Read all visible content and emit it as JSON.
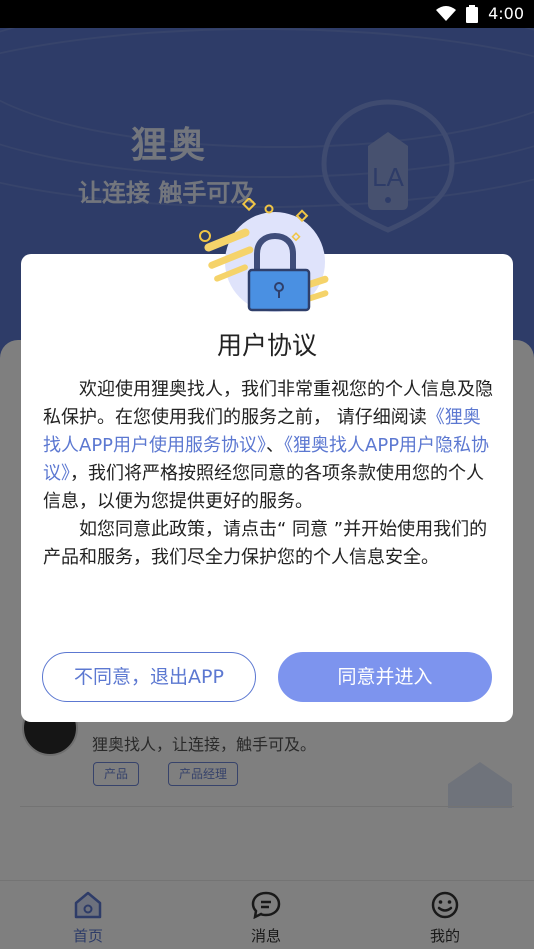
{
  "status_bar": {
    "time": "4:00"
  },
  "hero": {
    "title": "狸奥",
    "slogan": "让连接 触手可及",
    "logo_text": "LA"
  },
  "card": {
    "description": "狸奥找人，让连接，触手可及。",
    "tags": [
      "产品",
      "产品经理"
    ]
  },
  "bottom_nav": {
    "home": "首页",
    "messages": "消息",
    "me": "我的"
  },
  "dialog": {
    "title": "用户协议",
    "para1_a": "欢迎使用狸奥找人，我们非常重视您的个人信息及隐私保护。在您使用我们的服务之前， 请仔细阅读",
    "link1": "《狸奥找人APP用户使用服务协议》",
    "para1_b": "、",
    "link2": "《狸奥找人APP用户隐私协议》",
    "para1_c": "，我们将严格按照经您同意的各项条款使用您的个人信息，以便为您提供更好的服务。",
    "para2": "如您同意此政策，请点击“ 同意 ”并开始使用我们的产品和服务，我们尽全力保护您的个人信息安全。",
    "decline_label": "不同意，退出APP",
    "accept_label": "同意并进入"
  },
  "colors": {
    "accent": "#5c78d1",
    "accept_button": "#7d94ee",
    "overlay": "#000000"
  },
  "icons": {
    "wifi": "wifi-icon",
    "battery": "battery-icon",
    "lock": "lock-icon",
    "home": "home-icon",
    "messages": "chat-icon",
    "me": "smile-icon"
  }
}
